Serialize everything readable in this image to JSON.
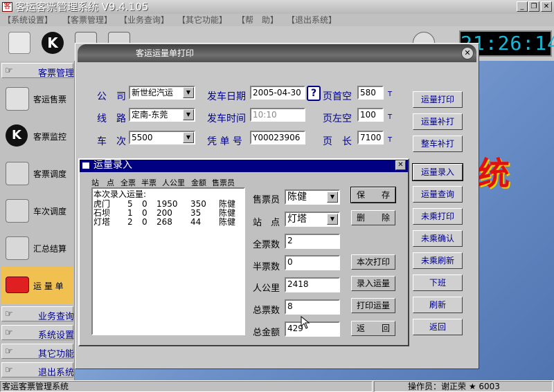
{
  "app": {
    "title": "客运客票管理系统 V9.4.105"
  },
  "menu": [
    "【系统设置】",
    "【客票管理】",
    "【业务查询】",
    "【其它功能】",
    "【帮　助】",
    "【退出系统】"
  ],
  "clock": "21:26:14",
  "sidebar": {
    "top_header": "客票管理",
    "items": [
      "客运售票",
      "客票监控",
      "客票调度",
      "车次调度",
      "汇总结算",
      "运 量 单"
    ],
    "bottom_headers": [
      "业务查询",
      "系统设置",
      "其它功能",
      "退出系统"
    ]
  },
  "background_text": "统",
  "main": {
    "title": "客运运量单打印",
    "labels": {
      "company": "公　司",
      "route": "线　路",
      "trip": "车　次",
      "depart_date": "发车日期",
      "depart_time": "发车时间",
      "voucher": "凭 单 号",
      "top_margin": "页首空",
      "left_margin": "页左空",
      "page_len": "页　长"
    },
    "values": {
      "company": "新世纪汽运",
      "route": "定南-东莞",
      "trip": "5500",
      "depart_date": "2005-04-30",
      "depart_time": "10:10",
      "voucher": "Y00023906",
      "top_margin": "580",
      "left_margin": "100",
      "page_len": "7100"
    },
    "unit": "T",
    "help_btn": "?",
    "buttons": [
      "运量打印",
      "运量补打",
      "整车补打",
      "运量录入",
      "运量查询",
      "未乘打印",
      "未乘确认",
      "未乘刷新",
      "下班",
      "刷新",
      "返回"
    ]
  },
  "dialog": {
    "title": "运量录入",
    "columns": [
      "站　点",
      "全票",
      "半票",
      "人公里",
      "金额",
      "售票员"
    ],
    "list_header": "本次录入运量:",
    "rows": [
      [
        "虎门",
        "5",
        "0",
        "1950",
        "350",
        "陈健"
      ],
      [
        "石坝",
        "1",
        "0",
        "200",
        "35",
        "陈健"
      ],
      [
        "灯塔",
        "2",
        "0",
        "268",
        "44",
        "陈健"
      ]
    ],
    "labels": {
      "seller": "售票员",
      "station": "站　点",
      "full": "全票数",
      "half": "半票数",
      "pkm": "人公里",
      "total_count": "总票数",
      "total_amount": "总金额"
    },
    "values": {
      "seller": "陈健",
      "station": "灯塔",
      "full": "2",
      "half": "0",
      "pkm": "2418",
      "total_count": "8",
      "total_amount": "429"
    },
    "buttons": {
      "save": "保　　存",
      "delete": "删　　除",
      "print_this": "本次打印",
      "enter": "录入运量",
      "print": "打印运量",
      "back": "返　　回"
    }
  },
  "status": {
    "left": "客运客票管理系统",
    "operator": "操作员：谢正荣 ★ 6003"
  }
}
